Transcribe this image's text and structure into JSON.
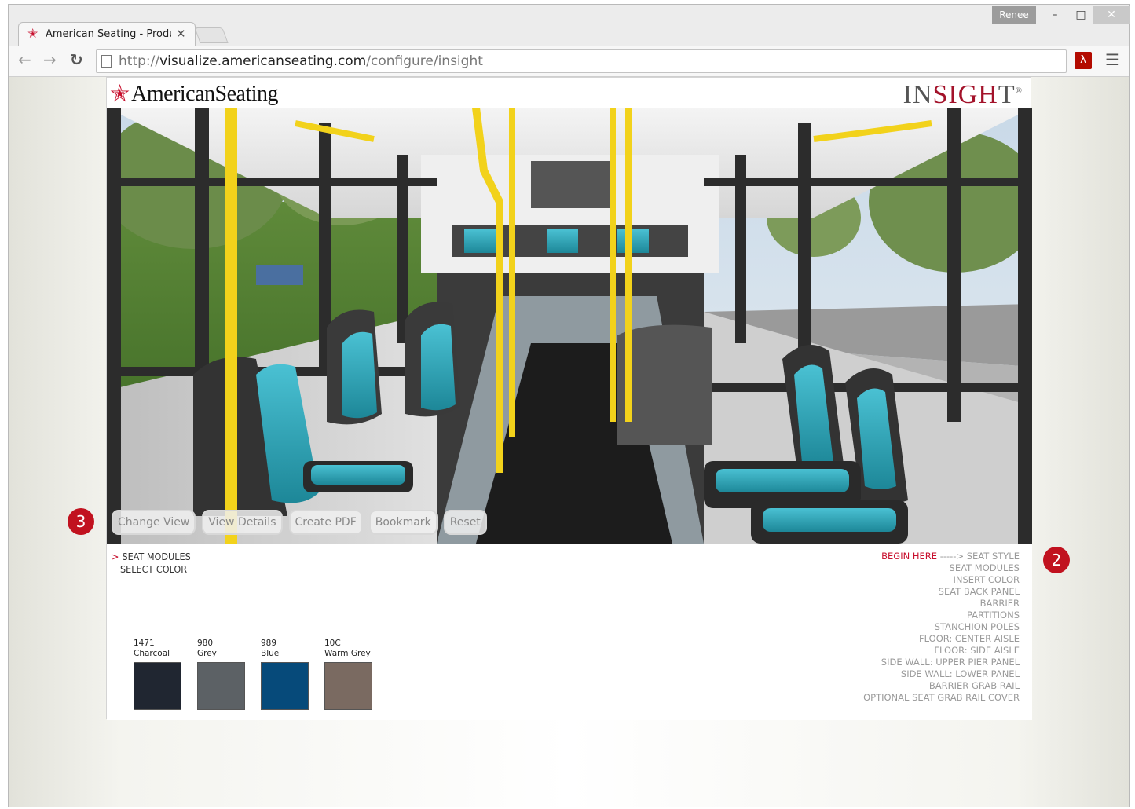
{
  "browser": {
    "user": "Renee",
    "tab_title": "American Seating - Produ",
    "url_scheme": "http://",
    "url_host": "visualize.americanseating.com",
    "url_path": "/configure/insight"
  },
  "header": {
    "brand": "AmericanSeating",
    "product_logo_prefix": "IN",
    "product_logo_accent": "SIGH",
    "product_logo_suffix": "T",
    "trademark": "®"
  },
  "view_buttons": [
    "Change View",
    "View Details",
    "Create PDF",
    "Bookmark",
    "Reset"
  ],
  "current_step": {
    "title": "SEAT MODULES",
    "subtitle": "SELECT COLOR"
  },
  "swatches": [
    {
      "code": "1471",
      "name": "Charcoal",
      "color": "#202631"
    },
    {
      "code": "980",
      "name": "Grey",
      "color": "#5c6165"
    },
    {
      "code": "989",
      "name": "Blue",
      "color": "#064a7a"
    },
    {
      "code": "10C",
      "name": "Warm Grey",
      "color": "#7a6a61"
    }
  ],
  "steps": {
    "begin_label": "BEGIN HERE",
    "items": [
      "-----> SEAT STYLE",
      "SEAT MODULES",
      "INSERT COLOR",
      "SEAT BACK PANEL",
      "BARRIER",
      "PARTITIONS",
      "STANCHION POLES",
      "FLOOR: CENTER AISLE",
      "FLOOR: SIDE AISLE",
      "SIDE WALL: UPPER PIER PANEL",
      "SIDE WALL: LOWER PANEL",
      "BARRIER GRAB RAIL",
      "OPTIONAL SEAT GRAB RAIL COVER"
    ]
  },
  "callouts": [
    "3",
    "2"
  ],
  "colors": {
    "brand_red": "#c8102e",
    "seat_insert": "#2aa3b5",
    "stanchion": "#f2d21b"
  }
}
